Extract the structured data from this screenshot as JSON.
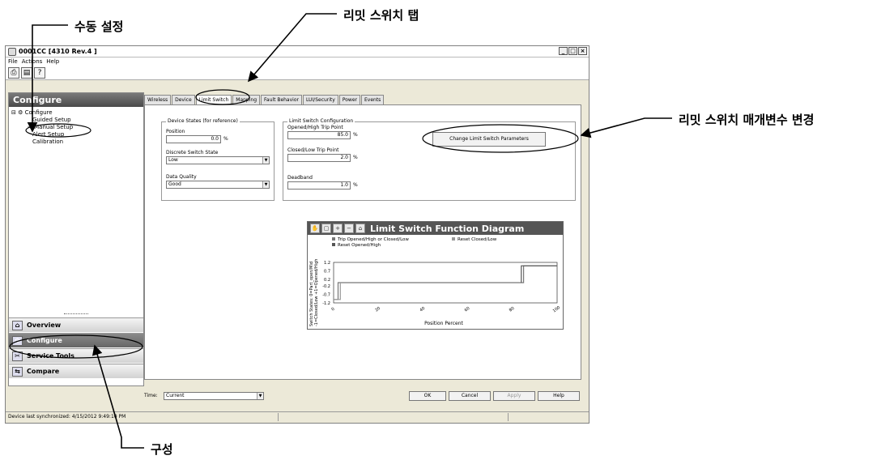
{
  "callouts": {
    "manual_setup": "수동 설정",
    "limit_switch_tab": "리밋 스위치 탭",
    "change_params": "리밋 스위치 매개변수 변경",
    "configure": "구성"
  },
  "window": {
    "title": "0001CC [4310 Rev.4 ]",
    "menu": [
      "File",
      "Actions",
      "Help"
    ],
    "controls": [
      "_",
      "□",
      "×"
    ]
  },
  "left_pane": {
    "header": "Configure",
    "tree": {
      "root": "Configure",
      "children": [
        "Guided Setup",
        "Manual Setup",
        "Alert Setup",
        "Calibration"
      ]
    },
    "nav": [
      {
        "label": "Overview"
      },
      {
        "label": "Configure"
      },
      {
        "label": "Service Tools"
      },
      {
        "label": "Compare"
      }
    ]
  },
  "tabs": [
    "Wireless",
    "Device",
    "Limit Switch",
    "Mapping",
    "Fault Behavior",
    "LUI/Security",
    "Power",
    "Events"
  ],
  "device_states": {
    "group_label": "Device States (for reference)",
    "position_label": "Position",
    "position_value": "0.0",
    "position_unit": "%",
    "discrete_label": "Discrete Switch State",
    "discrete_value": "Low",
    "quality_label": "Data Quality",
    "quality_value": "Good"
  },
  "limit_config": {
    "group_label": "Limit Switch Configuration",
    "opened_label": "Opened/High Trip Point",
    "opened_value": "85.0",
    "closed_label": "Closed/Low Trip Point",
    "closed_value": "2.0",
    "deadband_label": "Deadband",
    "deadband_value": "1.0",
    "unit": "%",
    "change_button": "Change Limit Switch Parameters"
  },
  "chart_data": {
    "type": "line",
    "title": "Limit Switch Function Diagram",
    "xlabel": "Position Percent",
    "ylabel_lines": [
      "Switch States:  0=Part_open/Mid",
      "-1=Closed/Low  +1=Opened/High"
    ],
    "xlim": [
      0,
      100
    ],
    "ylim": [
      -1.2,
      1.2
    ],
    "xticks": [
      "0",
      "20",
      "40",
      "60",
      "80",
      "100"
    ],
    "yticks": [
      "1.2",
      "0.7",
      "0.2",
      "-0.2",
      "-0.7",
      "-1.2"
    ],
    "legend": [
      "Trip Opened/High or Closed/Low",
      "Reset Closed/Low",
      "Reset Opened/High"
    ],
    "series": [
      {
        "name": "Trip Opened/High or Closed/Low",
        "points": [
          [
            0,
            -1
          ],
          [
            2,
            -1
          ],
          [
            2,
            0
          ],
          [
            85,
            0
          ],
          [
            85,
            1
          ],
          [
            100,
            1
          ]
        ]
      },
      {
        "name": "Reset Closed/Low",
        "points": [
          [
            0,
            -1
          ],
          [
            3,
            -1
          ],
          [
            3,
            0
          ]
        ]
      },
      {
        "name": "Reset Opened/High",
        "points": [
          [
            84,
            0
          ],
          [
            84,
            1
          ],
          [
            100,
            1
          ]
        ]
      }
    ]
  },
  "bottom": {
    "time_label": "Time:",
    "time_value": "Current",
    "buttons": [
      "OK",
      "Cancel",
      "Apply",
      "Help"
    ]
  },
  "status": {
    "text": "Device last synchronized: 4/15/2012 9:49:10 PM"
  }
}
